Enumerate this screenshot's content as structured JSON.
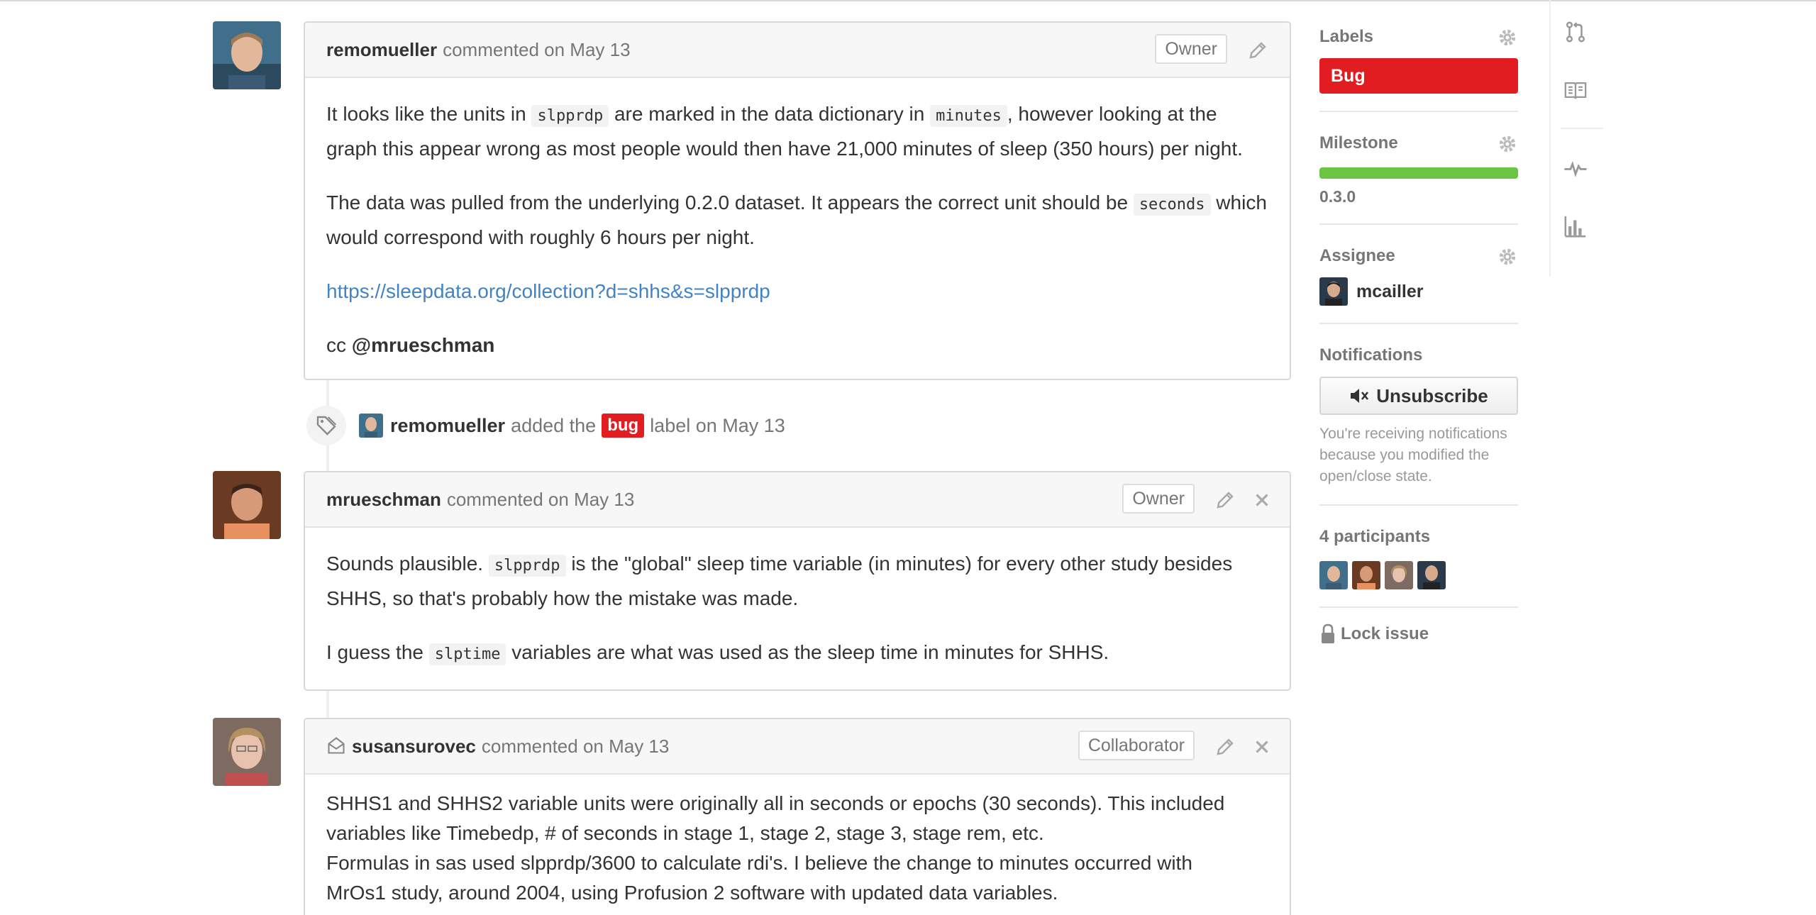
{
  "comments": [
    {
      "author": "remomueller",
      "meta": "commented on May 13",
      "role": "Owner",
      "body": {
        "p1_a": "It looks like the units in ",
        "p1_code1": "slpprdp",
        "p1_b": " are marked in the data dictionary in ",
        "p1_code2": "minutes",
        "p1_c": ", however looking at the graph this appear wrong as most people would then have 21,000 minutes of sleep (350 hours) per night.",
        "p2_a": "The data was pulled from the underlying 0.2.0 dataset. It appears the correct unit should be ",
        "p2_code": "seconds",
        "p2_b": " which would correspond with roughly 6 hours per night.",
        "link": "https://sleepdata.org/collection?d=shhs&s=slpprdp",
        "cc": "cc ",
        "mention": "@mrueschman"
      }
    },
    {
      "author": "mrueschman",
      "meta": "commented on May 13",
      "role": "Owner",
      "body": {
        "p1_a": "Sounds plausible. ",
        "p1_code": "slpprdp",
        "p1_b": " is the \"global\" sleep time variable (in minutes) for every other study besides SHHS, so that's probably how the mistake was made.",
        "p2_a": "I guess the ",
        "p2_code": "slptime",
        "p2_b": " variables are what was used as the sleep time in minutes for SHHS."
      }
    },
    {
      "author": "susansurovec",
      "meta": "commented on May 13",
      "role": "Collaborator",
      "body": {
        "line1": "SHHS1 and SHHS2 variable units were originally all in seconds or epochs (30 seconds).  This included",
        "line2": "variables like Timebedp, # of seconds in stage 1, stage 2, stage 3, stage rem, etc.",
        "line3": "Formulas in sas used slpprdp/3600 to calculate rdi's.    I believe the change to minutes occurred with",
        "line4": "MrOs1  study, around 2004, using Profusion 2 software with updated data variables."
      }
    }
  ],
  "event": {
    "author": "remomueller",
    "pre": "added the",
    "label": "bug",
    "post": "label on May 13"
  },
  "sidebar": {
    "labels_heading": "Labels",
    "label": "Bug",
    "label_color": "#e11d21",
    "milestone_heading": "Milestone",
    "milestone_name": "0.3.0",
    "milestone_progress": 1.0,
    "assignee_heading": "Assignee",
    "assignee": "mcailler",
    "notifications_heading": "Notifications",
    "unsubscribe": "Unsubscribe",
    "notif_text": "You're receiving notifications because you modified the open/close state.",
    "participants_heading": "4 participants",
    "lock": "Lock issue"
  },
  "icons": [
    "pull-request-icon",
    "book-icon",
    "pulse-icon",
    "graph-icon",
    "gear-icon",
    "pencil-icon",
    "close-icon",
    "tag-icon",
    "mute-icon",
    "lock-icon",
    "email-icon"
  ]
}
